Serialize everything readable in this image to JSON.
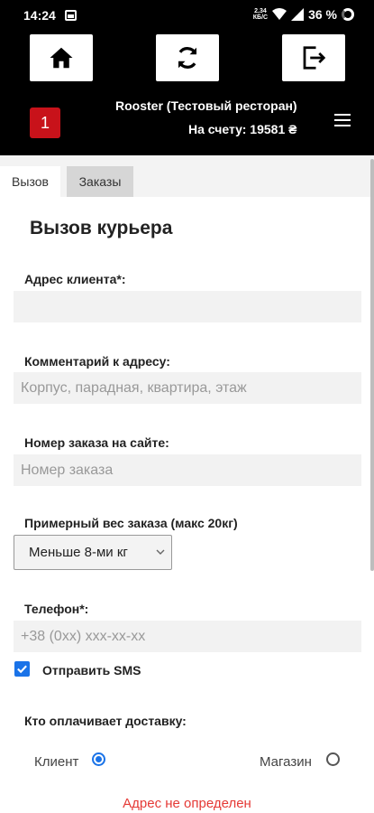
{
  "status_bar": {
    "time": "14:24",
    "net_speed_top": "2,34",
    "net_speed_bottom": "КБ/С",
    "battery": "36 %"
  },
  "header": {
    "badge": "1",
    "restaurant": "Rooster (Тестовый ресторан)",
    "balance": "На счету: 19581 ₴",
    "icons": [
      "home-icon",
      "refresh-icon",
      "logout-icon",
      "menu-icon"
    ]
  },
  "tabs": [
    {
      "label": "Вызов",
      "active": true
    },
    {
      "label": "Заказы",
      "active": false
    }
  ],
  "form": {
    "title": "Вызов курьера",
    "address_label": "Адрес клиента*:",
    "address_value": "",
    "comment_label": "Комментарий к адресу:",
    "comment_placeholder": "Корпус, парадная, квартира, этаж",
    "order_label": "Номер заказа на сайте:",
    "order_placeholder": "Номер заказа",
    "weight_label": "Примерный вес заказа (макс 20кг)",
    "weight_selected": "Меньше 8-ми кг",
    "phone_label": "Телефон*:",
    "phone_placeholder": "+38 (0xx) xxx-xx-xx",
    "sms_label": "Отправить SMS",
    "sms_checked": true,
    "payer_label": "Кто оплачивает доставку:",
    "payer_options": [
      {
        "label": "Клиент",
        "selected": true
      },
      {
        "label": "Магазин",
        "selected": false
      }
    ],
    "error": "Адрес не определен"
  },
  "colors": {
    "header_bg": "#000000",
    "badge": "#c8121a",
    "accent": "#1a73e8",
    "error": "#e53935"
  }
}
